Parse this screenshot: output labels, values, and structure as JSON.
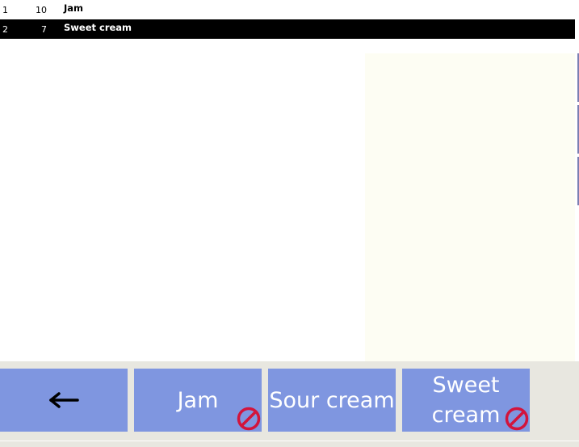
{
  "order": {
    "rows": [
      {
        "number": "1",
        "quantity": "10",
        "name": "Jam",
        "selected": false
      },
      {
        "number": "2",
        "quantity": "7",
        "name": "Sweet cream",
        "selected": true
      }
    ]
  },
  "buttons": {
    "back": {
      "icon": "left-arrow-icon"
    },
    "items": [
      {
        "label": "Jam",
        "blocked": true,
        "icon": "no-entry-icon"
      },
      {
        "label": "Sour cream",
        "blocked": false
      },
      {
        "label": "Sweet cream",
        "blocked": true,
        "icon": "no-entry-icon"
      }
    ]
  },
  "colors": {
    "button_bg": "#7f96e0",
    "selected_row_bg": "#000000",
    "bar_bg": "#e8e7e0",
    "no_entry": "#d2143c",
    "right_pane_bg": "#fdfdf3"
  }
}
